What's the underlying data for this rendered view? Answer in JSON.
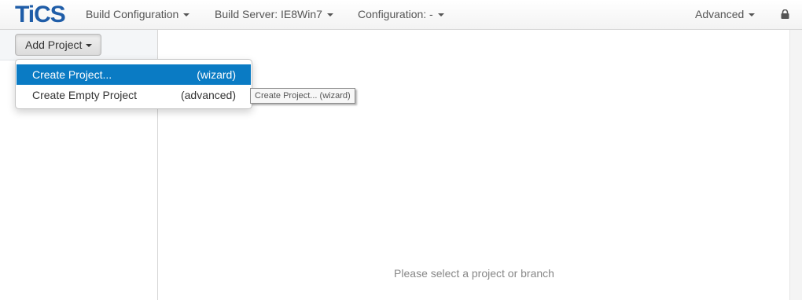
{
  "brand": {
    "logo_text": "TiCS"
  },
  "navbar": {
    "build_configuration": "Build Configuration",
    "build_server": "Build Server: IE8Win7",
    "configuration": "Configuration: -",
    "advanced": "Advanced",
    "lock_icon": "lock-icon"
  },
  "sidebar": {
    "add_project_label": "Add Project"
  },
  "add_project_menu": {
    "items": [
      {
        "label": "Create Project...",
        "hint": "(wizard)",
        "highlighted": true
      },
      {
        "label": "Create Empty Project",
        "hint": "(advanced)",
        "highlighted": false
      }
    ]
  },
  "tooltip": {
    "text": "Create Project... (wizard)"
  },
  "main": {
    "placeholder": "Please select a project or branch"
  },
  "colors": {
    "brand": "#1f5da8",
    "menu_highlight": "#0a7bc4"
  }
}
